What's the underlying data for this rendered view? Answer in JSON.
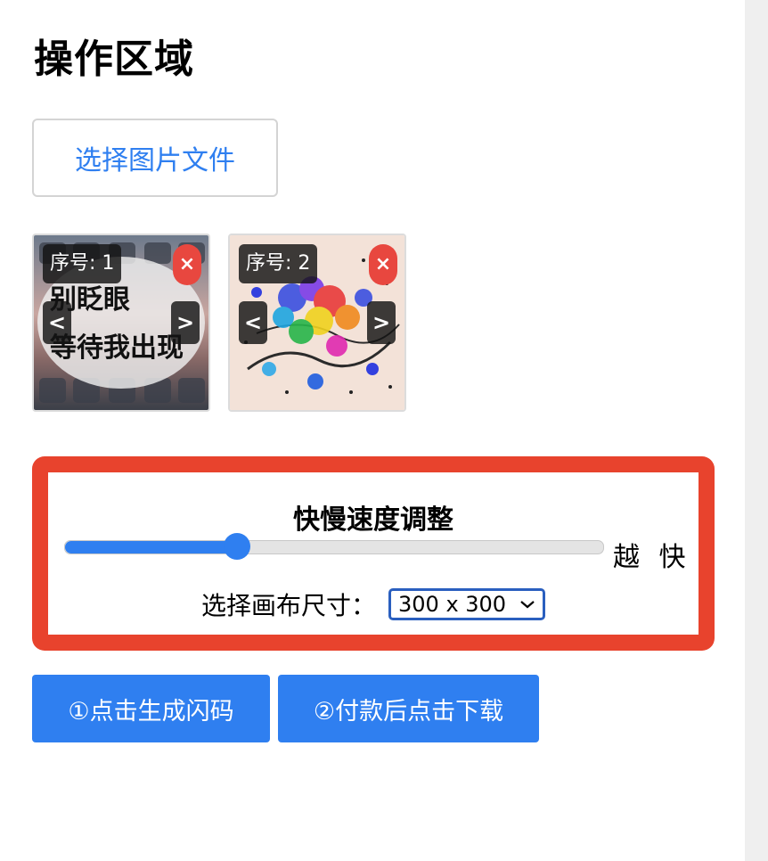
{
  "page": {
    "title": "操作区域"
  },
  "upload": {
    "button_label": "选择图片文件"
  },
  "thumbnails": [
    {
      "badge": "序号: 1",
      "close": "×",
      "prev": "<",
      "next": ">",
      "image_text": [
        "别眨眼",
        "等待我出现"
      ]
    },
    {
      "badge": "序号: 2",
      "close": "×",
      "prev": "<",
      "next": ">"
    }
  ],
  "speed": {
    "title": "快慢速度调整",
    "end_label": "越 快",
    "value_fraction": 0.32,
    "accent": "#2f7ff0"
  },
  "canvas": {
    "label": "选择画布尺寸：",
    "selected": "300 x 300"
  },
  "actions": {
    "generate": "①点击生成闪码",
    "download": "②付款后点击下载"
  },
  "colors": {
    "accent": "#2f7ff0",
    "highlight_border": "#e8432d",
    "close": "#e8473f"
  },
  "icons": {
    "select_arrow": "chevron-down-icon"
  }
}
